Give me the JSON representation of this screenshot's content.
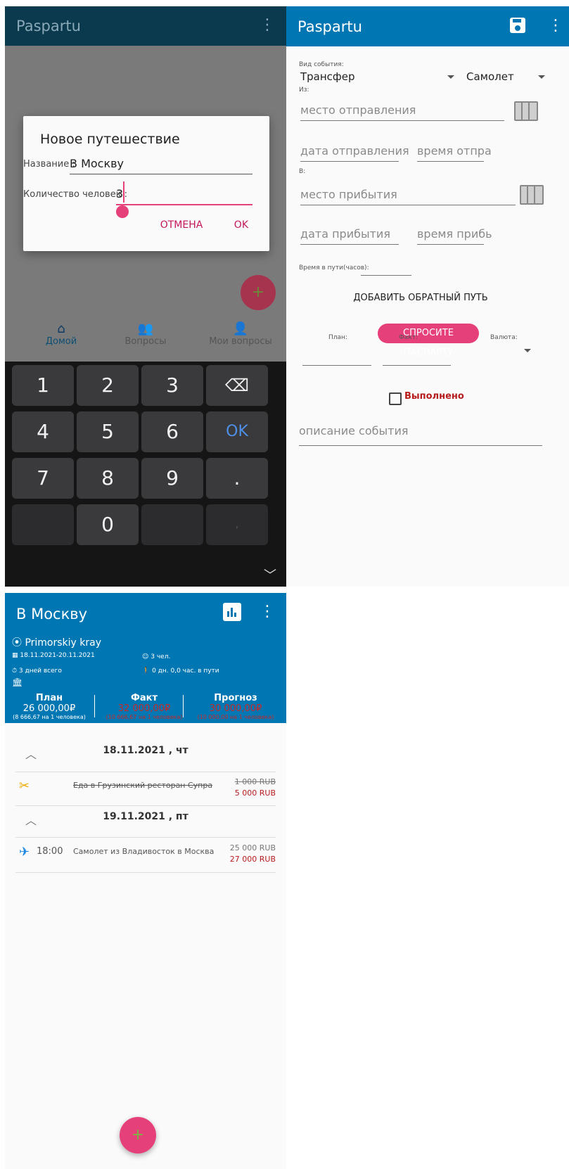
{
  "screen1": {
    "app_title": "Paspartu",
    "dialog": {
      "title": "Новое путешествие",
      "name_label": "Название :",
      "name_value": "В Москву",
      "people_label": "Количество человек :",
      "people_value": "3",
      "cancel": "ОТМЕНА",
      "ok": "OK"
    },
    "bottom_nav": [
      {
        "label": "Домой",
        "icon": "home-icon"
      },
      {
        "label": "Вопросы",
        "icon": "people-icon"
      },
      {
        "label": "Мои вопросы",
        "icon": "person-icon"
      }
    ],
    "keypad": [
      "1",
      "2",
      "3",
      "⌫",
      "4",
      "5",
      "6",
      "OK",
      "7",
      "8",
      "9",
      ".",
      "",
      "0",
      "",
      ","
    ]
  },
  "screen2": {
    "app_title": "Paspartu",
    "event_type_label": "Вид события:",
    "event_type": "Трансфер",
    "transport": "Самолет",
    "from_label": "Из:",
    "from_placeholder": "место отправления",
    "dep_date": "дата отправления",
    "dep_time": "время отпра",
    "to_label": "В:",
    "to_placeholder": "место прибытия",
    "arr_date": "дата прибытия",
    "arr_time": "время прибь",
    "travel_time_label": "Время в пути(часов):",
    "add_return": "ДОБАВИТЬ ОБРАТНЫЙ ПУТЬ",
    "ask_button": "СПРОСИТЕ ПАСПАРТУ",
    "plan_label": "План:",
    "fact_label": "Факт:",
    "currency_label": "Валюта:",
    "done_label": "Выполнено",
    "description_placeholder": "описание события"
  },
  "screen3": {
    "title": "В Москву",
    "location": "Primorskiy kray",
    "dates": "18.11.2021-20.11.2021",
    "people": "3 чел.",
    "days_total": "3 дней всего",
    "on_the_way": "0 дн. 0,0 час. в пути",
    "plan_label": "План",
    "plan_value": "26 000,00₽",
    "plan_sub": "(8 666,67 на 1 человека)",
    "fact_label": "Факт",
    "fact_value": "32 000,00₽",
    "fact_sub": "(10 666,67 на 1 человека)",
    "forecast_label": "Прогноз",
    "forecast_value": "30 000,00₽",
    "forecast_sub": "(10 000,00 на 1 человека)",
    "days": [
      {
        "date": "18.11.2021 , чт",
        "events": [
          {
            "time": "",
            "name": "Еда в Грузинский ресторан Супра",
            "plan": "1 000 RUB",
            "fact": "5 000 RUB",
            "done": true
          }
        ]
      },
      {
        "date": "19.11.2021 , пт",
        "events": [
          {
            "time": "18:00",
            "name": "Самолет из Владивосток  в Москва",
            "plan": "25 000 RUB",
            "fact": "27 000 RUB",
            "done": false
          }
        ]
      }
    ],
    "colors": {
      "primary": "#0077b3",
      "accent": "#e6407a",
      "negative": "#b71c1c"
    }
  }
}
